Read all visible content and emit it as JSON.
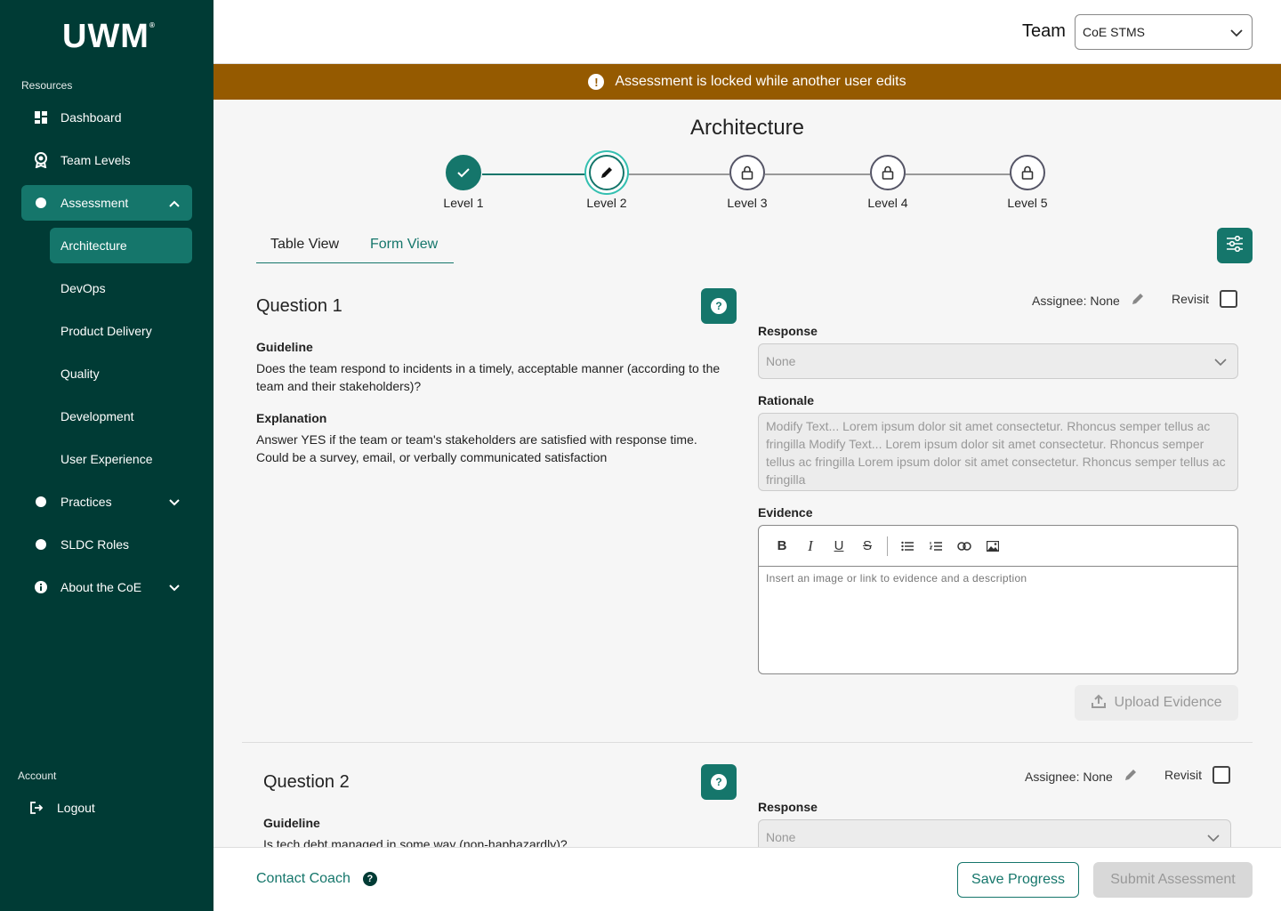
{
  "brand": {
    "logo": "UWM",
    "mark": "®"
  },
  "sidebar": {
    "resources_label": "Resources",
    "items": [
      {
        "label": "Dashboard"
      },
      {
        "label": "Team Levels"
      },
      {
        "label": "Assessment"
      },
      {
        "label": "Practices"
      },
      {
        "label": "SLDC Roles"
      },
      {
        "label": "About the CoE"
      }
    ],
    "assessment_sub": [
      {
        "label": "Architecture"
      },
      {
        "label": "DevOps"
      },
      {
        "label": "Product Delivery"
      },
      {
        "label": "Quality"
      },
      {
        "label": "Development"
      },
      {
        "label": "User Experience"
      }
    ],
    "account_label": "Account",
    "logout": "Logout"
  },
  "header": {
    "team_label": "Team",
    "team_value": "CoE STMS"
  },
  "banner": {
    "text": "Assessment is locked while another user edits",
    "color": "#955a00"
  },
  "page": {
    "title": "Architecture"
  },
  "stepper": [
    {
      "label": "Level 1",
      "state": "complete"
    },
    {
      "label": "Level 2",
      "state": "current"
    },
    {
      "label": "Level 3",
      "state": "locked"
    },
    {
      "label": "Level 4",
      "state": "locked"
    },
    {
      "label": "Level 5",
      "state": "locked"
    }
  ],
  "tabs": {
    "table": "Table View",
    "form": "Form View",
    "active": "Form View"
  },
  "questions": [
    {
      "title": "Question 1",
      "guideline_label": "Guideline",
      "guideline": "Does the team respond to incidents in a timely, acceptable manner (according to the team and their stakeholders)?",
      "explanation_label": "Explanation",
      "explanation": "Answer YES if the team or team's stakeholders are satisfied with response time. Could be a survey, email, or verbally communicated satisfaction",
      "assignee": "Assignee: None",
      "revisit": "Revisit",
      "response_label": "Response",
      "response_value": "None",
      "rationale_label": "Rationale",
      "rationale": "Modify Text... Lorem ipsum dolor sit amet consectetur. Rhoncus semper tellus ac fringilla Modify Text... Lorem ipsum dolor sit amet consectetur. Rhoncus semper tellus ac fringilla Lorem ipsum dolor sit amet consectetur. Rhoncus semper tellus ac fringilla",
      "evidence_label": "Evidence",
      "evidence_placeholder": "Insert an image or link to evidence and a description",
      "upload": "Upload Evidence"
    },
    {
      "title": "Question 2",
      "guideline_label": "Guideline",
      "guideline": "Is tech debt managed in some way (non-haphazardly)?",
      "assignee": "Assignee: None",
      "revisit": "Revisit",
      "response_label": "Response",
      "response_value": "None"
    }
  ],
  "footer": {
    "contact": "Contact Coach",
    "save": "Save Progress",
    "submit": "Submit Assessment"
  },
  "colors": {
    "primary": "#15766b",
    "sidebar": "#003b35",
    "accent": "#33bfb0"
  }
}
